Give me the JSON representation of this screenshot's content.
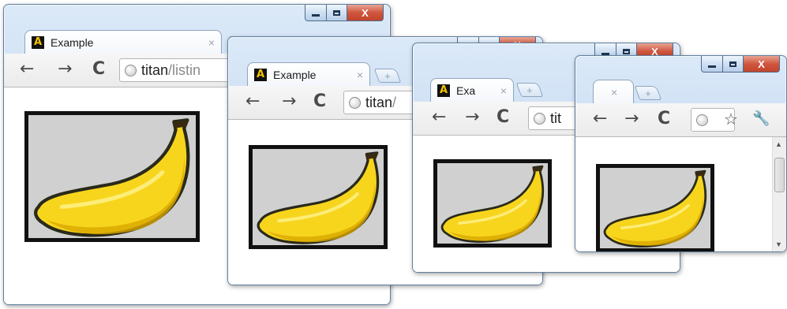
{
  "windows": [
    {
      "tab_title": "Example",
      "tab_close": "×",
      "new_tab": "",
      "back_icon": "←",
      "forward_icon": "→",
      "reload_icon": "C",
      "url_host": "titan",
      "url_path": "/listin",
      "close_glyph": "X"
    },
    {
      "tab_title": "Example",
      "tab_close": "×",
      "new_tab": "+",
      "back_icon": "←",
      "forward_icon": "→",
      "reload_icon": "C",
      "url_host": "titan",
      "url_path": "/",
      "close_glyph": "X"
    },
    {
      "tab_title": "Exa",
      "tab_close": "×",
      "new_tab": "+",
      "back_icon": "←",
      "forward_icon": "→",
      "reload_icon": "C",
      "url_host": "tit",
      "url_path": "",
      "close_glyph": "X"
    },
    {
      "tab_title": "",
      "tab_close": "×",
      "new_tab": "+",
      "back_icon": "←",
      "forward_icon": "→",
      "reload_icon": "C",
      "star_icon": "☆",
      "wrench_icon": "🔧",
      "close_glyph": "X"
    }
  ],
  "favicon_letter": "A",
  "image_alt": "banana",
  "colors": {
    "banana_fill": "#f7d51d",
    "banana_shade": "#d9a700",
    "banana_outline": "#2a2a1a",
    "picture_bg": "#d0d0d0",
    "frame_dark": "#5f7f9f",
    "close_red": "#c8492f"
  }
}
